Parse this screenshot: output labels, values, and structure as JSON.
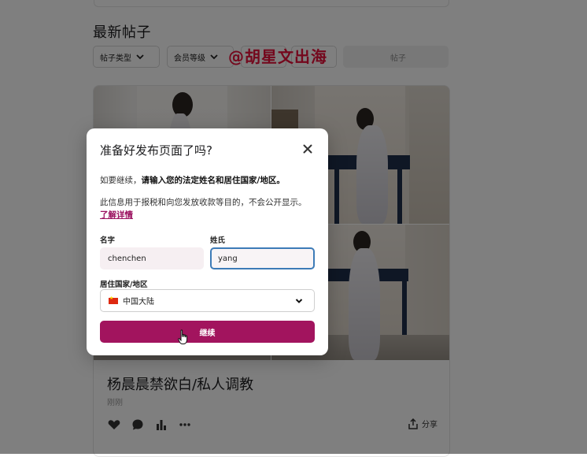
{
  "section": {
    "title": "最新帖子"
  },
  "filters": {
    "post_type": "帖子类型",
    "member_level": "会员等级",
    "search_placeholder": "帖子"
  },
  "watermark": "@胡星文出海",
  "post": {
    "title": "杨晨晨禁欲白/私人调教",
    "time": "刚刚",
    "share_label": "分享"
  },
  "modal": {
    "title": "准备好发布页面了吗?",
    "intro_prefix": "如要继续，",
    "intro_bold": "请输入您的法定姓名和居住国家/地区。",
    "info_text": "此信息用于报税和向您发放收款等目的，不会公开显示。",
    "learn_more": "了解详情",
    "first_name_label": "名字",
    "first_name_value": "chenchen",
    "last_name_label": "姓氏",
    "last_name_value": "yang",
    "country_label": "居住国家/地区",
    "country_value": "中国大陆",
    "continue_label": "继续"
  },
  "colors": {
    "accent": "#a2145e",
    "link": "#9b1260",
    "focus_border": "#3d7bb7",
    "watermark": "#e8103a"
  },
  "icons": [
    "chevron-down-icon",
    "close-icon",
    "heart-icon",
    "comment-icon",
    "stats-icon",
    "more-icon",
    "share-icon",
    "cn-flag-icon",
    "hand-cursor-icon"
  ]
}
